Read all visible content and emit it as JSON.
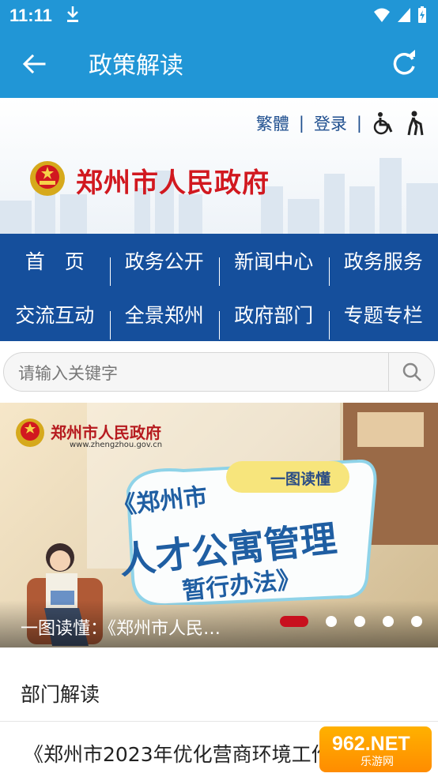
{
  "status": {
    "time": "11:11"
  },
  "appbar": {
    "title": "政策解读"
  },
  "site": {
    "links": [
      "繁體",
      "登录"
    ],
    "name": "郑州市人民政府"
  },
  "nav": {
    "row1": [
      "首　页",
      "政务公开",
      "新闻中心",
      "政务服务"
    ],
    "row2": [
      "交流互动",
      "全景郑州",
      "政府部门",
      "专题专栏"
    ]
  },
  "search": {
    "placeholder": "请输入关键字"
  },
  "banner": {
    "logo_text": "郑州市人民政府",
    "url": "www.zhengzhou.gov.cn",
    "pill": "一图读懂",
    "line1": "《郑州市",
    "line2": "人才公寓管理",
    "line3": "暂行办法》",
    "caption": "一图读懂：《郑州市人民…",
    "active_index": 0
  },
  "section": {
    "title": "部门解读"
  },
  "news": {
    "item": "《郑州市2023年优化营商环境工作"
  },
  "watermark": {
    "brand": "962.NET",
    "sub": "乐游网"
  },
  "colors": {
    "appbar": "#2196d6",
    "nav": "#154f9c",
    "red": "#c8101e"
  }
}
